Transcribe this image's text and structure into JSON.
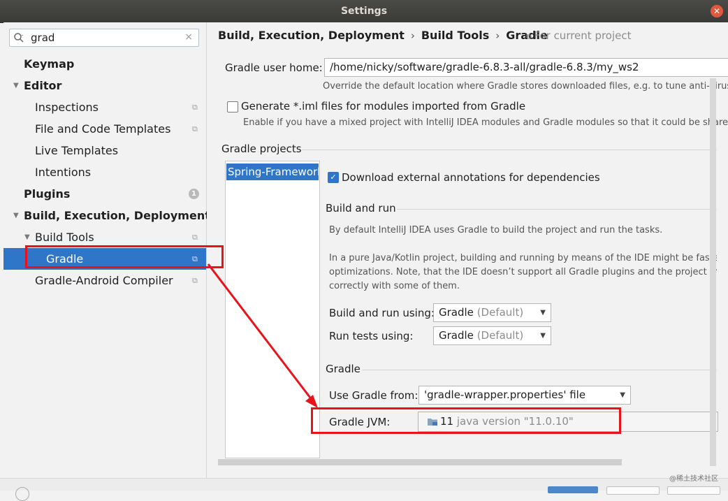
{
  "window": {
    "title": "Settings",
    "close_glyph": "✕"
  },
  "search": {
    "value": "grad",
    "clear_glyph": "×"
  },
  "tree": {
    "keymap": "Keymap",
    "editor": "Editor",
    "inspections": "Inspections",
    "file_code_templates": "File and Code Templates",
    "live_templates": "Live Templates",
    "intentions": "Intentions",
    "plugins": "Plugins",
    "plugins_badge": "1",
    "build_exec_deploy": "Build, Execution, Deployment",
    "build_tools": "Build Tools",
    "gradle": "Gradle",
    "gradle_android_compiler": "Gradle-Android Compiler"
  },
  "breadcrumb": {
    "part1": "Build, Execution, Deployment",
    "part2": "Build Tools",
    "part3": "Gradle",
    "separator": "›",
    "for_current_project": "For current project"
  },
  "gradle_home": {
    "label": "Gradle user home:",
    "value": "/home/nicky/software/gradle-6.8.3-all/gradle-6.8.3/my_ws2",
    "hint": "Override the default location where Gradle stores downloaded files, e.g. to tune anti-virus sof"
  },
  "generate_iml": {
    "label": "Generate *.iml files for modules imported from Gradle",
    "hint": "Enable if you have a mixed project with IntelliJ IDEA modules and Gradle modules so that it could be shared via",
    "checked": false
  },
  "gradle_projects": {
    "title": "Gradle projects",
    "items": [
      "Spring-Framework"
    ]
  },
  "download_annotations": {
    "label": "Download external annotations for dependencies",
    "checked": true
  },
  "build_and_run": {
    "title": "Build and run",
    "desc1": "By default IntelliJ IDEA uses Gradle to build the project and run the tasks.",
    "desc2": "In a pure Java/Kotlin project, building and running by means of the IDE might be faster, than",
    "desc3": "optimizations. Note, that the IDE doesn’t support all Gradle plugins and the project might",
    "desc4": "correctly with some of them.",
    "build_run_label": "Build and run using:",
    "build_run_value": "Gradle",
    "build_run_suffix": "(Default)",
    "run_tests_label": "Run tests using:",
    "run_tests_value": "Gradle",
    "run_tests_suffix": "(Default)"
  },
  "gradle_section": {
    "title": "Gradle",
    "use_from_label": "Use Gradle from:",
    "use_from_value": "'gradle-wrapper.properties' file",
    "jvm_label": "Gradle JVM:",
    "jvm_version": "11",
    "jvm_detail": "java version \"11.0.10\""
  },
  "watermark": "@稀土技术社区",
  "colors": {
    "accent": "#2f75c8",
    "annotation_red": "#e8141c"
  }
}
